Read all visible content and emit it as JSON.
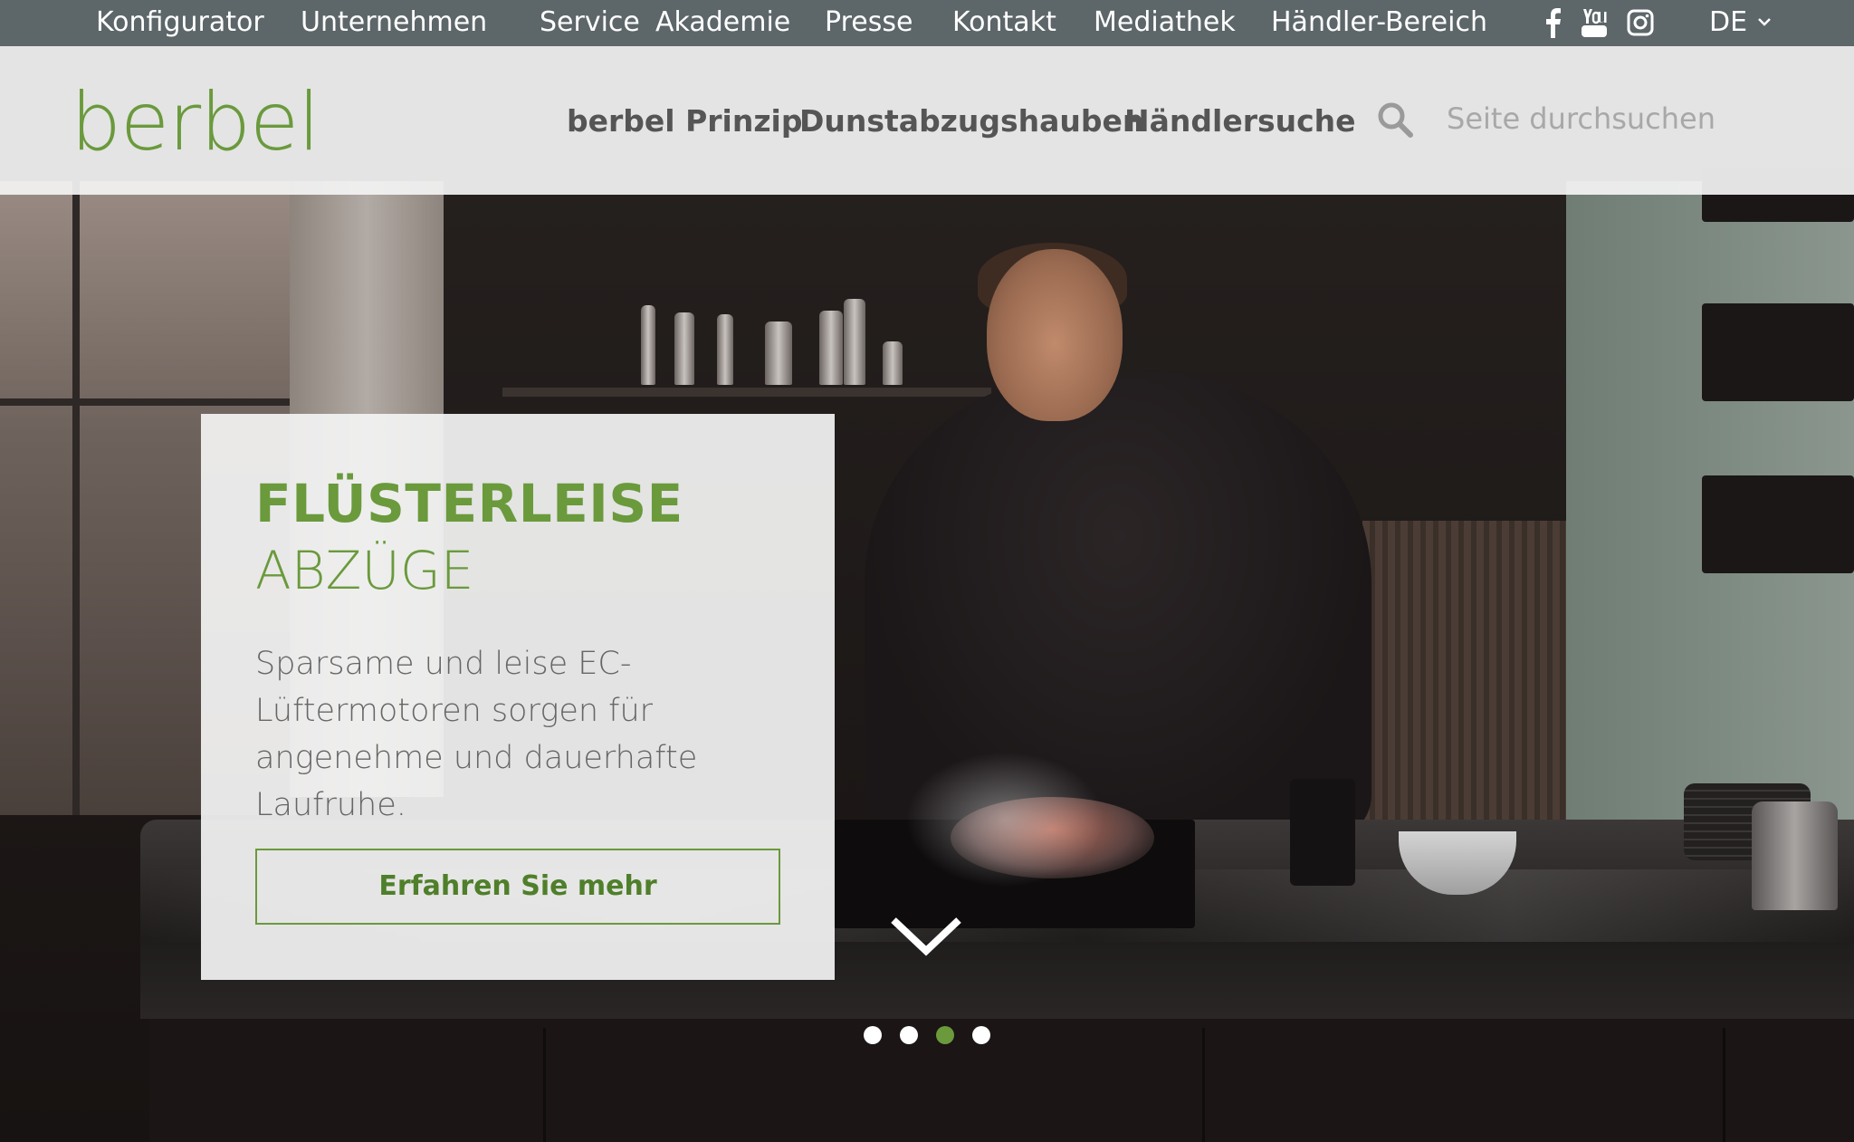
{
  "topbar": {
    "links": [
      "Konfigurator",
      "Unternehmen",
      "Service",
      "Akademie",
      "Presse",
      "Kontakt",
      "Mediathek",
      "Händler-Bereich"
    ],
    "social": [
      "facebook-icon",
      "youtube-icon",
      "instagram-icon"
    ],
    "language": "DE"
  },
  "header": {
    "logo": "berbel",
    "nav": [
      "berbel Prinzip",
      "Dunstabzugshauben",
      "Händlersuche"
    ],
    "search_placeholder": "Seite durchsuchen"
  },
  "slide": {
    "title_line1": "FLÜSTERLEISE",
    "title_line2": "ABZÜGE",
    "text_lines": [
      "Sparsame und leise EC-",
      "Lüftermotoren sorgen für",
      "angenehme und dauerhafte",
      "Laufruhe."
    ],
    "button": "Erfahren Sie mehr"
  },
  "slider": {
    "dot_count": 4,
    "active_index": 2
  },
  "colors": {
    "topbar_bg": "#5d6669",
    "brand_green": "#6a9a3c",
    "nav_text": "#555555",
    "body_text": "#666666"
  }
}
